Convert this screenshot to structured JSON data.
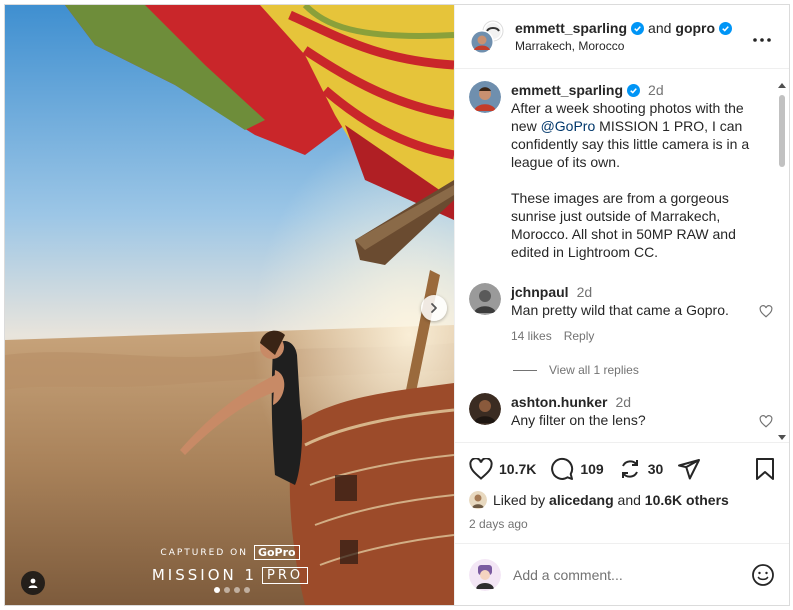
{
  "header": {
    "user1": "emmett_sparling",
    "joiner": "and",
    "user2": "gopro",
    "location": "Marrakech, Morocco",
    "more_icon": "more-horizontal-icon"
  },
  "media": {
    "watermark_captured": "CAPTURED ON",
    "watermark_brand": "GoPro",
    "watermark_model": "MISSION 1",
    "watermark_pro": "PRO",
    "carousel_total": 4,
    "carousel_active": 1
  },
  "caption": {
    "username": "emmett_sparling",
    "time": "2d",
    "text_before": "After a week shooting photos with the new ",
    "mention": "@GoPro",
    "text_after": " MISSION 1 PRO, I can confidently say this little camera is in a league of its own.\n\nThese images are from a gorgeous sunrise just outside of Marrakech, Morocco. All shot in 50MP RAW and edited in Lightroom CC."
  },
  "comments": [
    {
      "username": "jchnpaul",
      "time": "2d",
      "text": "Man pretty wild that came a Gopro.",
      "likes": "14 likes",
      "reply": "Reply",
      "view_replies": "View all 1 replies"
    },
    {
      "username": "ashton.hunker",
      "time": "2d",
      "text": "Any filter on the lens?"
    }
  ],
  "actions": {
    "like_count": "10.7K",
    "comment_count": "109",
    "repost_count": "30"
  },
  "likes": {
    "prefix": "Liked by",
    "user": "alicedang",
    "joiner": "and",
    "others": "10.6K others"
  },
  "posted": "2 days ago",
  "add_comment": {
    "placeholder": "Add a comment..."
  },
  "colors": {
    "verified": "#0095f6",
    "mention": "#00376b",
    "muted": "#737373",
    "text": "#262626"
  }
}
